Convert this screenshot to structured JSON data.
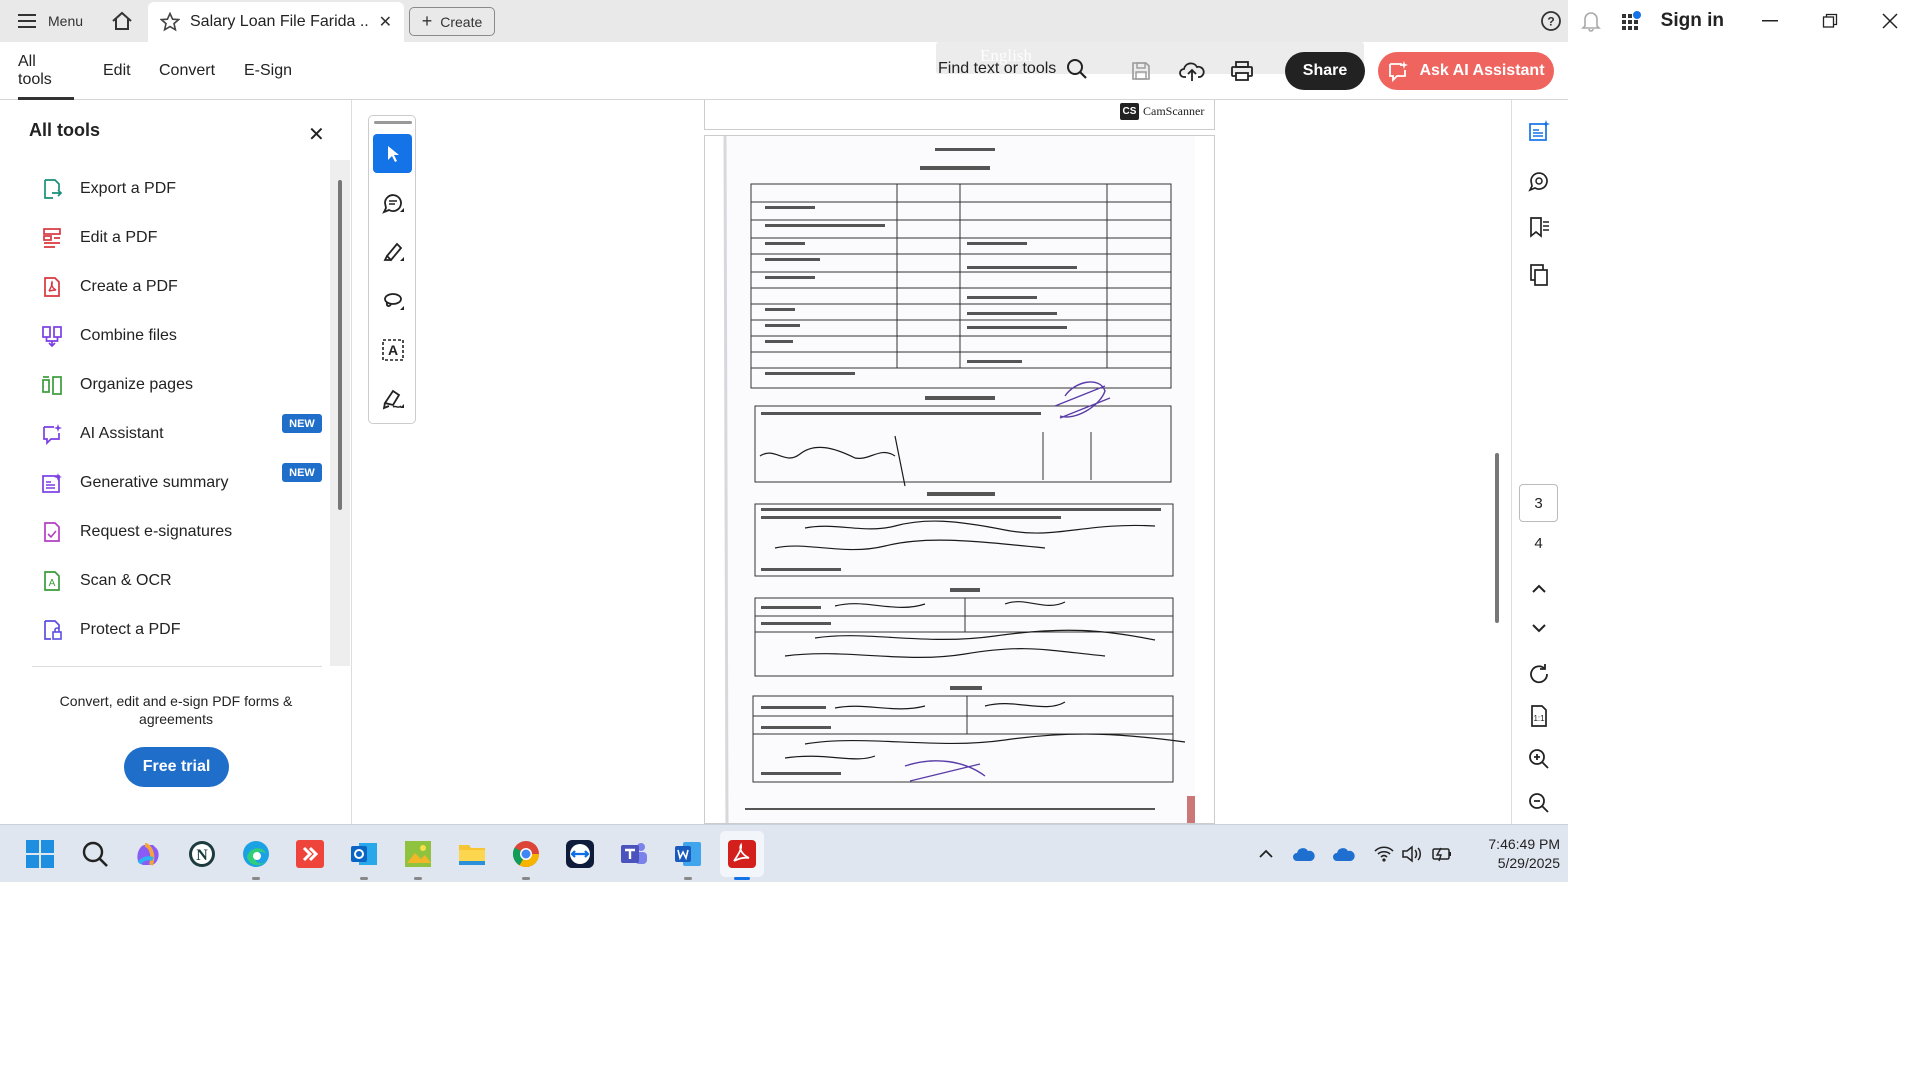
{
  "titlebar": {
    "menu_label": "Menu",
    "tab_title": "Salary Loan File Farida ...",
    "create_label": "Create",
    "signin_label": "Sign in"
  },
  "toolbar": {
    "tabs": [
      "All tools",
      "Edit",
      "Convert",
      "E-Sign"
    ],
    "find_label": "Find text or tools",
    "share_label": "Share",
    "ai_assistant_label": "Ask AI Assistant",
    "ghost_language": "English"
  },
  "left_panel": {
    "title": "All tools",
    "items": [
      {
        "label": "Export a PDF",
        "icon": "export-pdf-icon",
        "color": "#1a8f7a"
      },
      {
        "label": "Edit a PDF",
        "icon": "edit-pdf-icon",
        "color": "#d7373f"
      },
      {
        "label": "Create a PDF",
        "icon": "create-pdf-icon",
        "color": "#d7373f"
      },
      {
        "label": "Combine files",
        "icon": "combine-files-icon",
        "color": "#7b3fe4"
      },
      {
        "label": "Organize pages",
        "icon": "organize-pages-icon",
        "color": "#3a9b3a"
      },
      {
        "label": "AI Assistant",
        "icon": "ai-assistant-icon",
        "color": "#7b3fe4",
        "badge": "NEW"
      },
      {
        "label": "Generative summary",
        "icon": "generative-summary-icon",
        "color": "#7b3fe4",
        "badge": "NEW"
      },
      {
        "label": "Request e-signatures",
        "icon": "request-esignatures-icon",
        "color": "#b33ec4"
      },
      {
        "label": "Scan & OCR",
        "icon": "scan-ocr-icon",
        "color": "#3a9b3a"
      },
      {
        "label": "Protect a PDF",
        "icon": "protect-pdf-icon",
        "color": "#5a4fe0"
      }
    ],
    "promo_text": "Convert, edit and e-sign PDF forms & agreements",
    "trial_label": "Free trial"
  },
  "viewer": {
    "scanner_brand": "CamScanner",
    "current_page": "3",
    "next_page": "4"
  },
  "taskbar": {
    "time": "7:46:49 PM",
    "date": "5/29/2025"
  },
  "colors": {
    "accent": "#1473e6",
    "ai_button": "#f0645f",
    "share_button": "#222222",
    "badge": "#1f6ec9"
  }
}
